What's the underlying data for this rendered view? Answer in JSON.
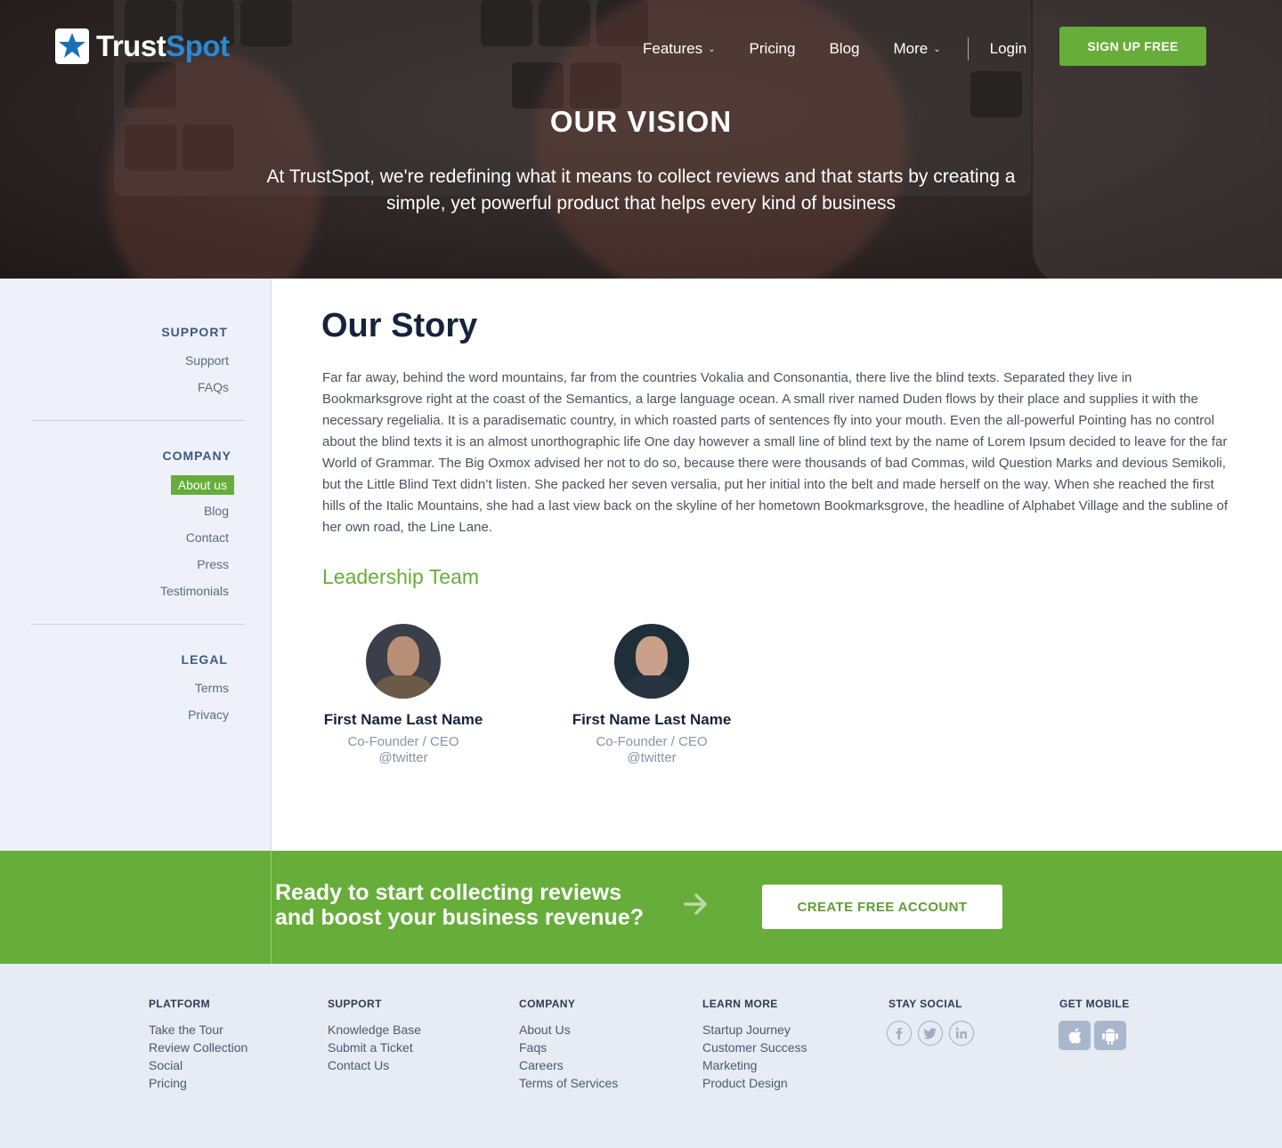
{
  "brand": {
    "name_part1": "Trust",
    "name_part2": "Spot"
  },
  "nav": {
    "items": [
      "Features",
      "Pricing",
      "Blog",
      "More"
    ],
    "login": "Login",
    "signup": "SIGN UP FREE"
  },
  "hero": {
    "title": "OUR VISION",
    "subtitle": "At TrustSpot, we're redefining what it means to collect reviews and that starts by creating a simple, yet powerful product that helps every kind of business"
  },
  "sidebar": {
    "support": {
      "title": "SUPPORT",
      "links": [
        "Support",
        "FAQs"
      ]
    },
    "company": {
      "title": "COMPANY",
      "active": "About us",
      "links": [
        "Blog",
        "Contact",
        "Press",
        "Testimonials"
      ]
    },
    "legal": {
      "title": "LEGAL",
      "links": [
        "Terms",
        "Privacy"
      ]
    }
  },
  "main": {
    "title": "Our Story",
    "story": "Far far away, behind the word mountains, far from the countries Vokalia and Consonantia, there live the blind texts. Separated they live in Bookmarksgrove right at the coast of the Semantics, a large language ocean. A small river named Duden flows by their place and supplies it with the necessary regelialia. It is a paradisematic country, in which roasted parts of sentences fly into your mouth. Even the all-powerful Pointing has no control about the blind texts it is an almost unorthographic life One day however a small line of blind text by the name of Lorem Ipsum decided to leave for the far World of Grammar. The Big Oxmox advised her not to do so, because there were thousands of bad Commas, wild Question Marks and devious Semikoli, but the Little Blind Text didn’t listen. She packed her seven versalia, put her initial into the belt and made herself on the way. When she reached the first hills of the Italic Mountains, she had a last view back on the skyline of her hometown Bookmarksgrove, the headline of Alphabet Village and the subline of her own road, the Line Lane.",
    "leadership_title": "Leadership Team",
    "team": [
      {
        "name": "First Name Last Name",
        "role": "Co-Founder / CEO",
        "twitter": "@twitter"
      },
      {
        "name": "First Name Last Name",
        "role": "Co-Founder / CEO",
        "twitter": "@twitter"
      }
    ]
  },
  "cta": {
    "line1": "Ready to start collecting reviews",
    "line2": "and boost your business revenue?",
    "button": "CREATE FREE ACCOUNT"
  },
  "footer": {
    "platform": {
      "title": "PLATFORM",
      "links": [
        "Take the Tour",
        "Review Collection",
        "Social",
        "Pricing"
      ]
    },
    "support": {
      "title": "SUPPORT",
      "links": [
        "Knowledge Base",
        "Submit a Ticket",
        "Contact Us"
      ]
    },
    "company": {
      "title": "COMPANY",
      "links": [
        "About Us",
        "Faqs",
        "Careers",
        "Terms of Services"
      ]
    },
    "learn": {
      "title": "LEARN MORE",
      "links": [
        "Startup Journey",
        "Customer Success",
        "Marketing",
        "Product Design"
      ]
    },
    "social": {
      "title": "STAY SOCIAL",
      "icons": [
        "facebook-icon",
        "twitter-icon",
        "linkedin-icon"
      ]
    },
    "mobile": {
      "title": "GET MOBILE",
      "icons": [
        "apple-icon",
        "android-icon"
      ]
    }
  },
  "colors": {
    "green": "#67ad3a",
    "blue": "#2a8ad4",
    "navy": "#17233a"
  }
}
